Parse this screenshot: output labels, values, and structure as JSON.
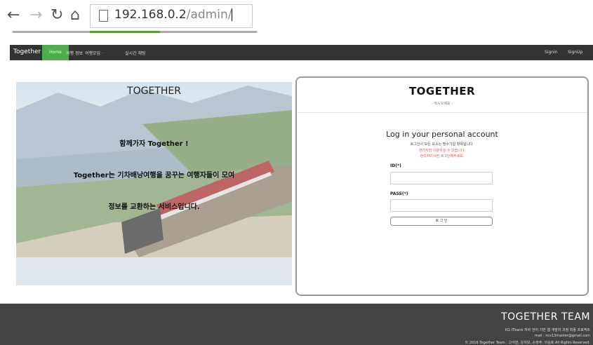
{
  "browser": {
    "url_host": "192.168.0.2",
    "url_path": "/admin/"
  },
  "navbar": {
    "brand": "Together",
    "home": "Home",
    "links": [
      "여행 정보",
      "여행모임 ·",
      "실시간 채팅"
    ],
    "signin": "Signin",
    "signup": "SignUp"
  },
  "hero": {
    "title": "TOGETHER",
    "line1": "함께가자 Together !",
    "line2": "Together는 기차배낭여행을 꿈꾸는 여행자들이 모여",
    "line3": "정보를 교환하는 서비스입니다."
  },
  "login": {
    "logo": "TOGETHER",
    "logo_sub": "- 아시오세요 -",
    "title": "Log in your personal account",
    "desc": "로그인시 모든 요소는 필수기입 항목입니다.",
    "warn1": "관리자만 이용하실 수 있습니다.",
    "warn2": "관리자이시면 로그인해주세요.",
    "id_label": "ID(*)",
    "pass_label": "PASS(*)",
    "button": "로 그 인"
  },
  "footer": {
    "team": "TOGETHER TEAM",
    "line1": "KG ITbank 자바 언어 기반 웹 개발자 과정 최종 프로젝트",
    "line2": "mail : ncs13master@gmail.com",
    "line3": "© 2016 Together Team : 고석현, 유지보, 손정주, 이승호 All Rights Reserved."
  },
  "colors": {
    "navbar": "#333333",
    "nav_active": "#4cae4c",
    "footer": "#444444",
    "warning": "#d9534f"
  },
  "icons": [
    "back-arrow-icon",
    "forward-arrow-icon",
    "reload-icon",
    "home-icon",
    "page-icon"
  ]
}
